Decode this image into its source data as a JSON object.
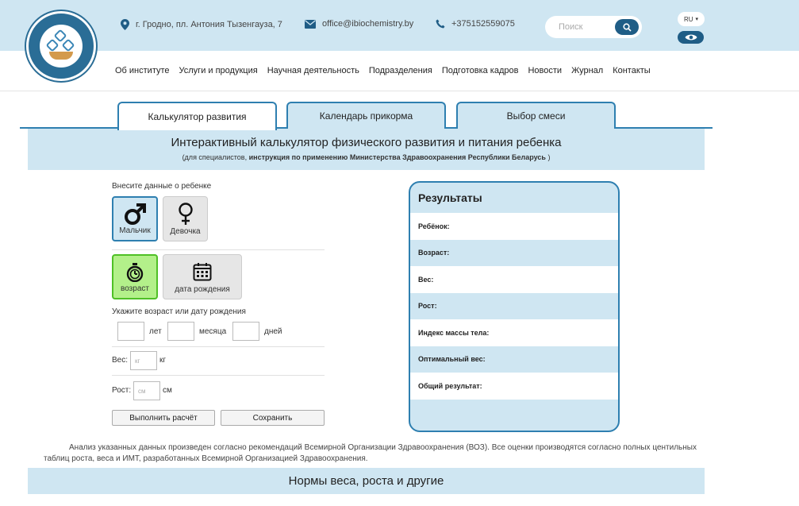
{
  "header": {
    "address": "г. Гродно, пл. Антония Тызенгауза, 7",
    "email": "office@ibiochemistry.by",
    "phone": "+375152559075",
    "search_placeholder": "Поиск",
    "lang": "RU"
  },
  "nav": [
    "Об институте",
    "Услуги и продукция",
    "Научная деятельность",
    "Подразделения",
    "Подготовка кадров",
    "Новости",
    "Журнал",
    "Контакты"
  ],
  "tabs": [
    "Калькулятор развития",
    "Календарь прикорма",
    "Выбор смеси"
  ],
  "banner": {
    "title": "Интерактивный калькулятор физического развития и питания ребенка",
    "sub_prefix": "(для специалистов, ",
    "sub_bold": "инструкция по применению Министерства Здравоохранения Республики Беларусь",
    "sub_suffix": " )"
  },
  "form": {
    "enter_label": "Внесите данные о ребенке",
    "boy": "Мальчик",
    "girl": "Девочка",
    "age": "возраст",
    "birthdate": "дата рождения",
    "age_hint": "Укажите возраст или дату рождения",
    "years": "лет",
    "months": "месяца",
    "days": "дней",
    "weight_label": "Вес:",
    "weight_placeholder": "кг",
    "weight_unit": "кг",
    "height_label": "Рост:",
    "height_placeholder": "см",
    "height_unit": "см",
    "calc_button": "Выполнить расчёт",
    "save_button": "Сохранить"
  },
  "results": {
    "title": "Результаты",
    "rows": [
      "Ребёнок:",
      "Возраст:",
      "Вес:",
      "Рост:",
      "Индекс массы тела:",
      "Оптимальный вес:",
      "Общий результат:"
    ]
  },
  "footer": {
    "text": "Анализ указанных данных произведен согласно рекомендаций Всемирной Организации Здравоохранения (ВОЗ). Все оценки производятся согласно полных центильных таблиц роста, веса и ИМТ, разработанных Всемирной Организацией Здравоохранения.",
    "bottom_title": "Нормы веса, роста и другие"
  },
  "colors": {
    "accent": "#2e7fb0",
    "light_blue": "#cfe6f2",
    "dark_blue": "#1f5d86",
    "green": "#b3f08a"
  }
}
